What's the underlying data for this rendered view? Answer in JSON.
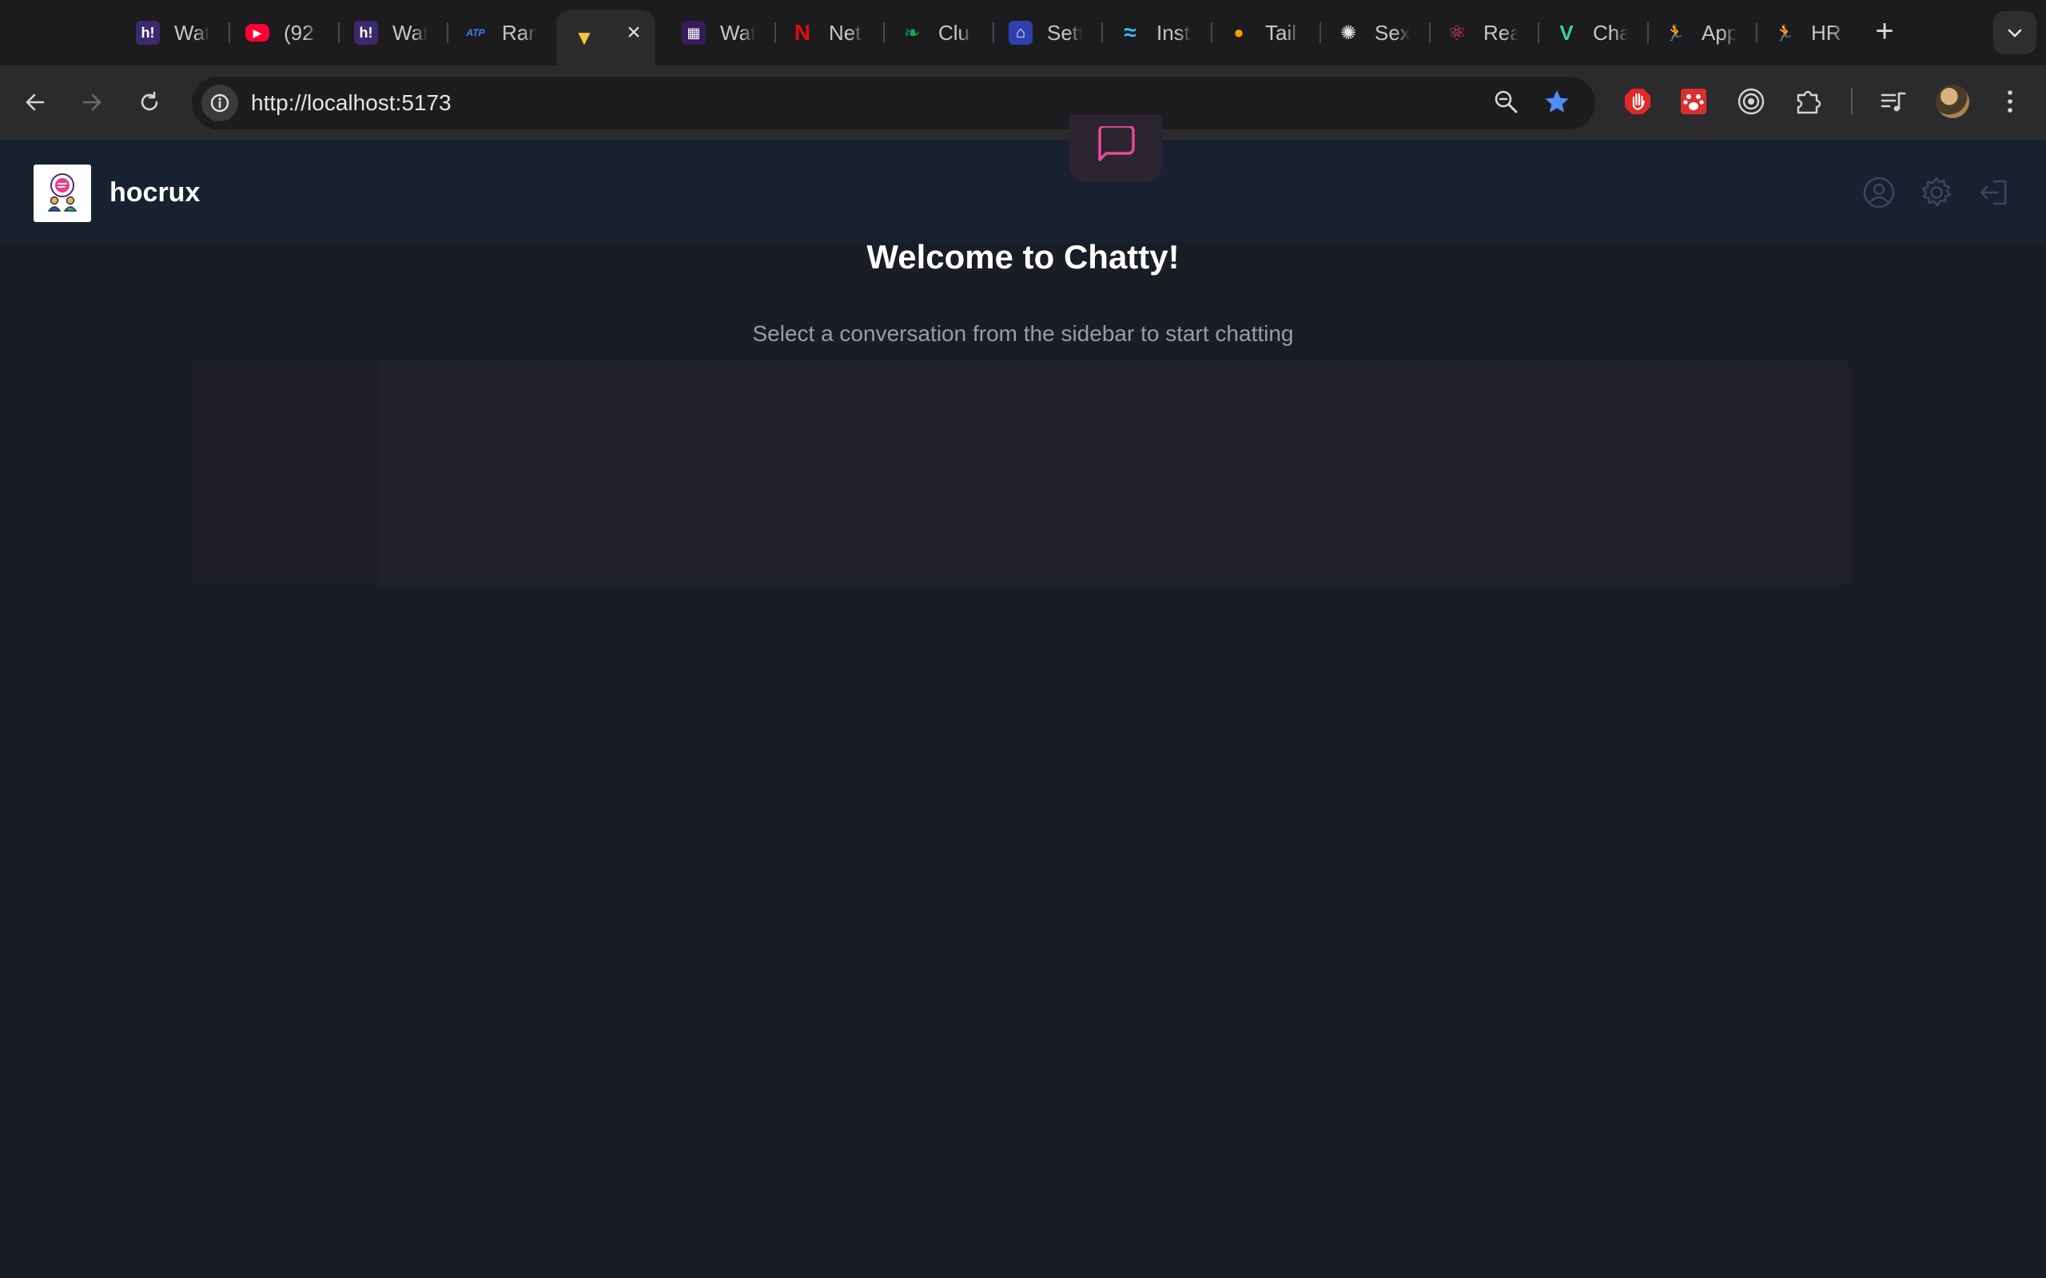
{
  "browser": {
    "tabs": [
      {
        "label": "Wat",
        "icon": "hackerearth-icon",
        "color": "#3b2a6d",
        "glyph": "h!"
      },
      {
        "label": "(92",
        "icon": "youtube-icon",
        "color": "#ff0033",
        "glyph": "▶"
      },
      {
        "label": "Wat",
        "icon": "hackerearth-icon",
        "color": "#3b2a6d",
        "glyph": "h!"
      },
      {
        "label": "Ran",
        "icon": "atp-icon",
        "color": "#1c1c1e",
        "glyph": "ATP"
      },
      {
        "label": "",
        "icon": "vite-icon",
        "color": "#2b2b2e",
        "glyph": "▼",
        "active": true
      },
      {
        "label": "Wat",
        "icon": "streaming-icon",
        "color": "#3a1a5a",
        "glyph": "▦"
      },
      {
        "label": "Net",
        "icon": "netflix-icon",
        "color": "#1c1c1e",
        "glyph": "N"
      },
      {
        "label": "Clu",
        "icon": "mongodb-leaf-icon",
        "color": "#1c1c1e",
        "glyph": "❧"
      },
      {
        "label": "Sett",
        "icon": "dashboard-icon",
        "color": "#2e3fb0",
        "glyph": "⌂"
      },
      {
        "label": "Inst",
        "icon": "tailwind-icon",
        "color": "#1c1c1e",
        "glyph": "≈"
      },
      {
        "label": "Tail",
        "icon": "person-icon",
        "color": "#1c1c1e",
        "glyph": "●"
      },
      {
        "label": "Sex",
        "icon": "openai-icon",
        "color": "#1c1c1e",
        "glyph": "✺"
      },
      {
        "label": "Rea",
        "icon": "react-icon",
        "color": "#1c1c1e",
        "glyph": "⚛"
      },
      {
        "label": "Cha",
        "icon": "vuetify-icon",
        "color": "#1c1c1e",
        "glyph": "V"
      },
      {
        "label": "App",
        "icon": "runner-icon",
        "color": "#1c1c1e",
        "glyph": "🏃"
      },
      {
        "label": "HR",
        "icon": "runner-icon",
        "color": "#1c1c1e",
        "glyph": "🏃"
      }
    ],
    "url": "http://localhost:5173"
  },
  "app": {
    "name": "hocrux",
    "welcome_title": "Welcome to Chatty!",
    "welcome_subtitle": "Select a conversation from the sidebar to start chatting",
    "accent": "#ec4899"
  }
}
